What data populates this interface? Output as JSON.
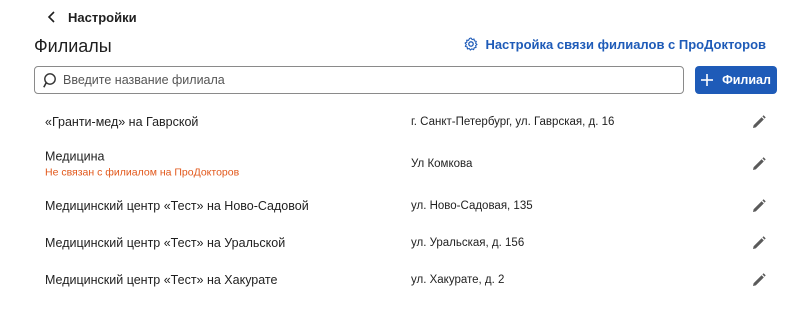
{
  "header": {
    "back_label": "Настройки",
    "title": "Филиалы",
    "settings_link_label": "Настройка связи филиалов с ПроДокторов"
  },
  "search": {
    "placeholder": "Введите название филиала",
    "value": ""
  },
  "add_button": {
    "label": "Филиал"
  },
  "colors": {
    "accent": "#1e5bb8",
    "warning": "#e2581b",
    "text": "#1f1f1f",
    "icon": "#5a5a5a"
  },
  "icons": {
    "back": "chevron-left-icon",
    "settings": "gear-icon",
    "search": "search-icon",
    "add": "plus-icon",
    "edit": "pencil-icon"
  },
  "branches": [
    {
      "name": "«Гранти-мед» на Гаврской",
      "warning": "",
      "address": "г. Санкт-Петербург, ул. Гаврская, д. 16"
    },
    {
      "name": "Медицина",
      "warning": "Не связан с филиалом на ПроДокторов",
      "address": "Ул Комкова"
    },
    {
      "name": "Медицинский центр «Тест» на Ново-Садовой",
      "warning": "",
      "address": "ул. Ново-Садовая, 135"
    },
    {
      "name": "Медицинский центр «Тест» на Уральской",
      "warning": "",
      "address": "ул. Уральская, д. 156"
    },
    {
      "name": "Медицинский центр «Тест» на Хакурате",
      "warning": "",
      "address": "ул. Хакурате, д. 2"
    }
  ]
}
